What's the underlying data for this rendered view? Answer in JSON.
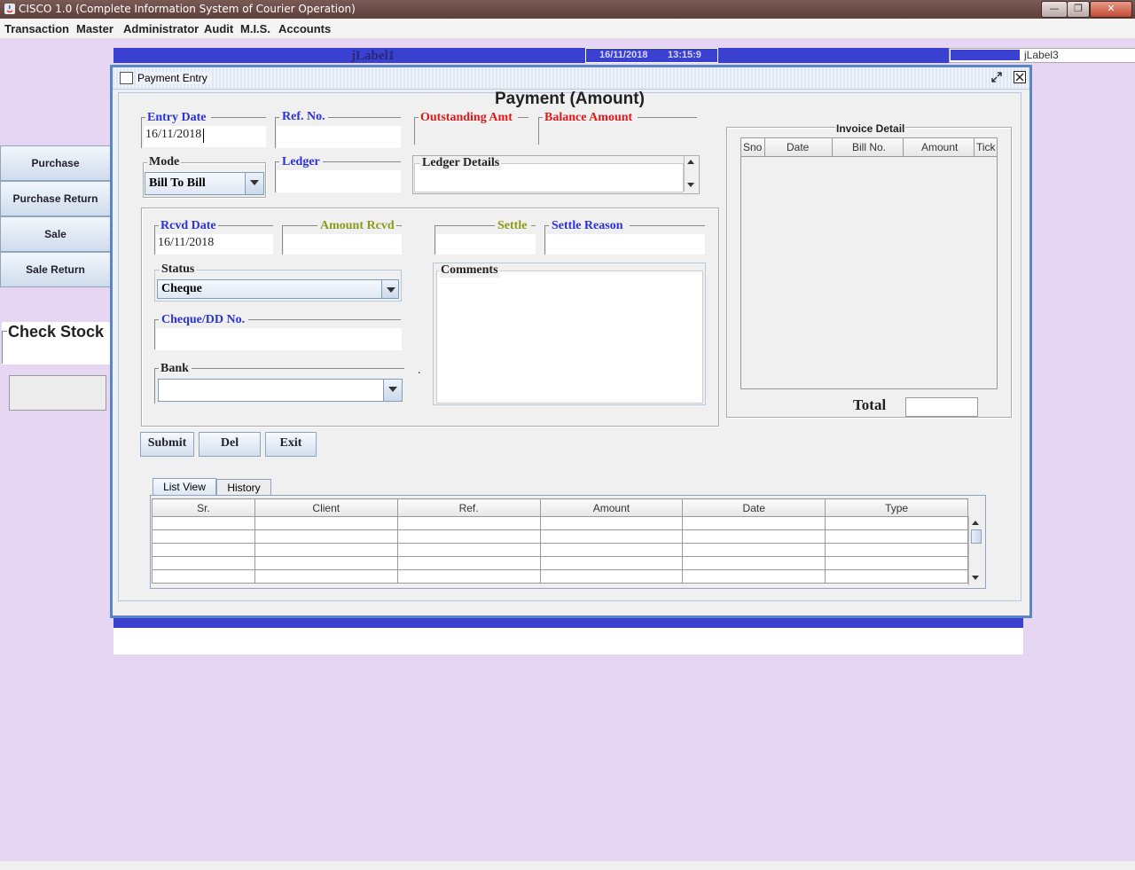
{
  "window": {
    "title": "CISCO 1.0 (Complete Information System of Courier Operation)",
    "buttons": {
      "minimize": "—",
      "maximize": "❐",
      "close": "✕"
    }
  },
  "menu": [
    "Transaction",
    "Master",
    "Administrator",
    "Audit",
    "M.I.S.",
    "Accounts"
  ],
  "status": {
    "label1": "jLabel1",
    "date": "16/11/2018",
    "time": "13:15:9",
    "label3": "jLabel3"
  },
  "sidebar": {
    "items": [
      "Purchase",
      "Purchase Return",
      "Sale",
      "Sale Return"
    ],
    "check_stock": "Check Stock"
  },
  "frame": {
    "title": "Payment Entry",
    "heading": "Payment (Amount)"
  },
  "form": {
    "entry_date": {
      "label": "Entry Date",
      "value": "16/11/2018"
    },
    "ref_no": {
      "label": "Ref. No.",
      "value": ""
    },
    "outstanding_amt": {
      "label": "Outstanding Amt",
      "value": ""
    },
    "balance_amount": {
      "label": "Balance Amount",
      "value": ""
    },
    "mode": {
      "label": "Mode",
      "value": "Bill To Bill"
    },
    "ledger": {
      "label": "Ledger",
      "value": ""
    },
    "ledger_details": {
      "label": "Ledger Details",
      "value": ""
    },
    "rcvd_date": {
      "label": "Rcvd Date",
      "value": "16/11/2018"
    },
    "amount_rcvd": {
      "label": "Amount Rcvd",
      "value": ""
    },
    "settle": {
      "label": "Settle",
      "value": ""
    },
    "settle_reason": {
      "label": "Settle Reason",
      "value": ""
    },
    "status": {
      "label": "Status",
      "value": "Cheque"
    },
    "cheque_no": {
      "label": "Cheque/DD No.",
      "value": ""
    },
    "bank": {
      "label": "Bank",
      "value": ""
    },
    "comments": {
      "label": "Comments",
      "value": ""
    },
    "dot": "."
  },
  "invoice": {
    "title": "Invoice Detail",
    "columns": [
      "Sno",
      "Date",
      "Bill No.",
      "Amount",
      "Tick"
    ],
    "total_label": "Total",
    "total_value": ""
  },
  "actions": {
    "submit": "Submit",
    "del": "Del",
    "exit": "Exit"
  },
  "tabs": [
    "List View",
    "History"
  ],
  "list": {
    "columns": [
      "Sr.",
      "Client",
      "Ref.",
      "Amount",
      "Date",
      "Type"
    ],
    "rows": 5
  }
}
